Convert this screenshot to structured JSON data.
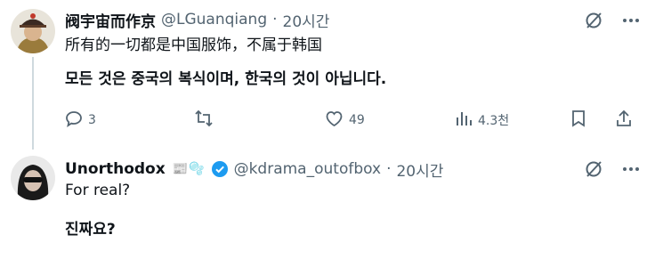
{
  "tweets": [
    {
      "display_name": "阀宇宙而作京",
      "handle": "@LGuanqiang",
      "separator": "·",
      "time": "20시간",
      "text": "所有的一切都是中国服饰，不属于韩国",
      "translation": "모든 것은 중국의 복식이며, 한국의 것이 아닙니다.",
      "stats": {
        "replies": "3",
        "likes": "49",
        "views": "4.3천"
      },
      "icons": {
        "grok": "grok-icon",
        "more": "more-icon",
        "reply": "reply-icon",
        "retweet": "retweet-icon",
        "like": "like-icon",
        "views": "views-icon",
        "bookmark": "bookmark-icon",
        "share": "share-icon"
      }
    },
    {
      "display_name": "Unorthodox",
      "emoji": "📰🫧",
      "handle": "@kdrama_outofbox",
      "separator": "·",
      "time": "20시간",
      "text": "For real?",
      "translation": "진짜요?",
      "verified_color": "#1d9bf0"
    }
  ]
}
